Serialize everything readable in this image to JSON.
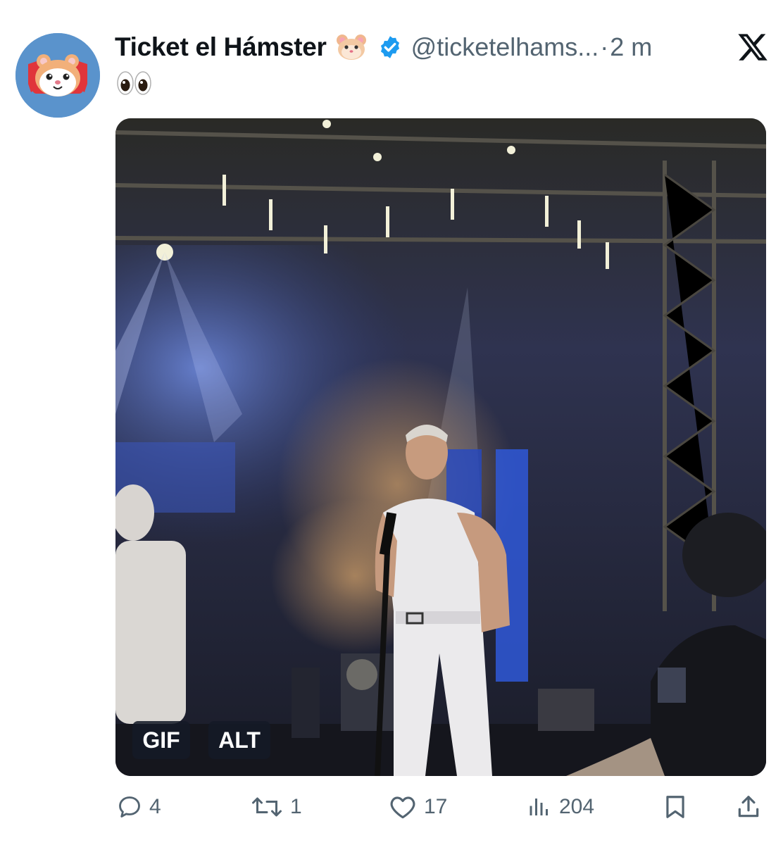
{
  "tweet": {
    "author_name": "Ticket el Hámster",
    "author_emoji": "hamster-emoji",
    "verified": true,
    "handle": "@ticketelhams...",
    "separator": "·",
    "time": "2 m",
    "text_emoji": "eyes-emoji",
    "avatar_icon": "hamster-ticket-logo"
  },
  "media": {
    "gif_label": "GIF",
    "alt_label": "ALT",
    "description_icon": "concert-stage-video-frame"
  },
  "actions": {
    "replies": "4",
    "reposts": "1",
    "likes": "17",
    "views": "204"
  },
  "colors": {
    "accent": "#1d9bf0",
    "muted": "#536471",
    "avatar_bg": "#5a93cc"
  }
}
